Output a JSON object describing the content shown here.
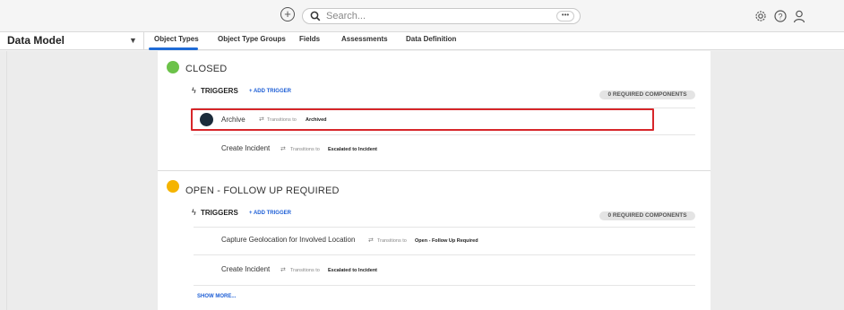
{
  "topbar": {
    "add_icon": "plus-circle-icon",
    "search_placeholder": "Search...",
    "search_more": "•••",
    "icons": [
      "gear-icon",
      "help-icon",
      "user-icon"
    ]
  },
  "nav": {
    "title": "Data Model",
    "tabs": [
      {
        "label": "Object Types",
        "active": true
      },
      {
        "label": "Object Type Groups"
      },
      {
        "label": "Fields"
      },
      {
        "label": "Assessments"
      },
      {
        "label": "Data Definition"
      }
    ]
  },
  "states": [
    {
      "title": "CLOSED",
      "color": "#6cc24a",
      "triggers_label": "TRIGGERS",
      "add_trigger": "+ ADD TRIGGER",
      "required": "0 REQUIRED COMPONENTS",
      "rows": [
        {
          "name": "Archive",
          "transitions_to": "Transitions to",
          "target": "Archived"
        },
        {
          "name": "Create Incident",
          "transitions_to": "Transitions to",
          "target": "Escalated to Incident"
        }
      ]
    },
    {
      "title": "OPEN - FOLLOW UP REQUIRED",
      "color": "#f5b400",
      "triggers_label": "TRIGGERS",
      "add_trigger": "+ ADD TRIGGER",
      "required": "0 REQUIRED COMPONENTS",
      "rows": [
        {
          "name": "Capture Geolocation for Involved Location",
          "transitions_to": "Transitions to",
          "target": "Open - Follow Up Required"
        },
        {
          "name": "Create Incident",
          "transitions_to": "Transitions to",
          "target": "Escalated to Incident"
        }
      ],
      "show_more": "SHOW MORE..."
    }
  ],
  "highlight_color": "#d7262a"
}
